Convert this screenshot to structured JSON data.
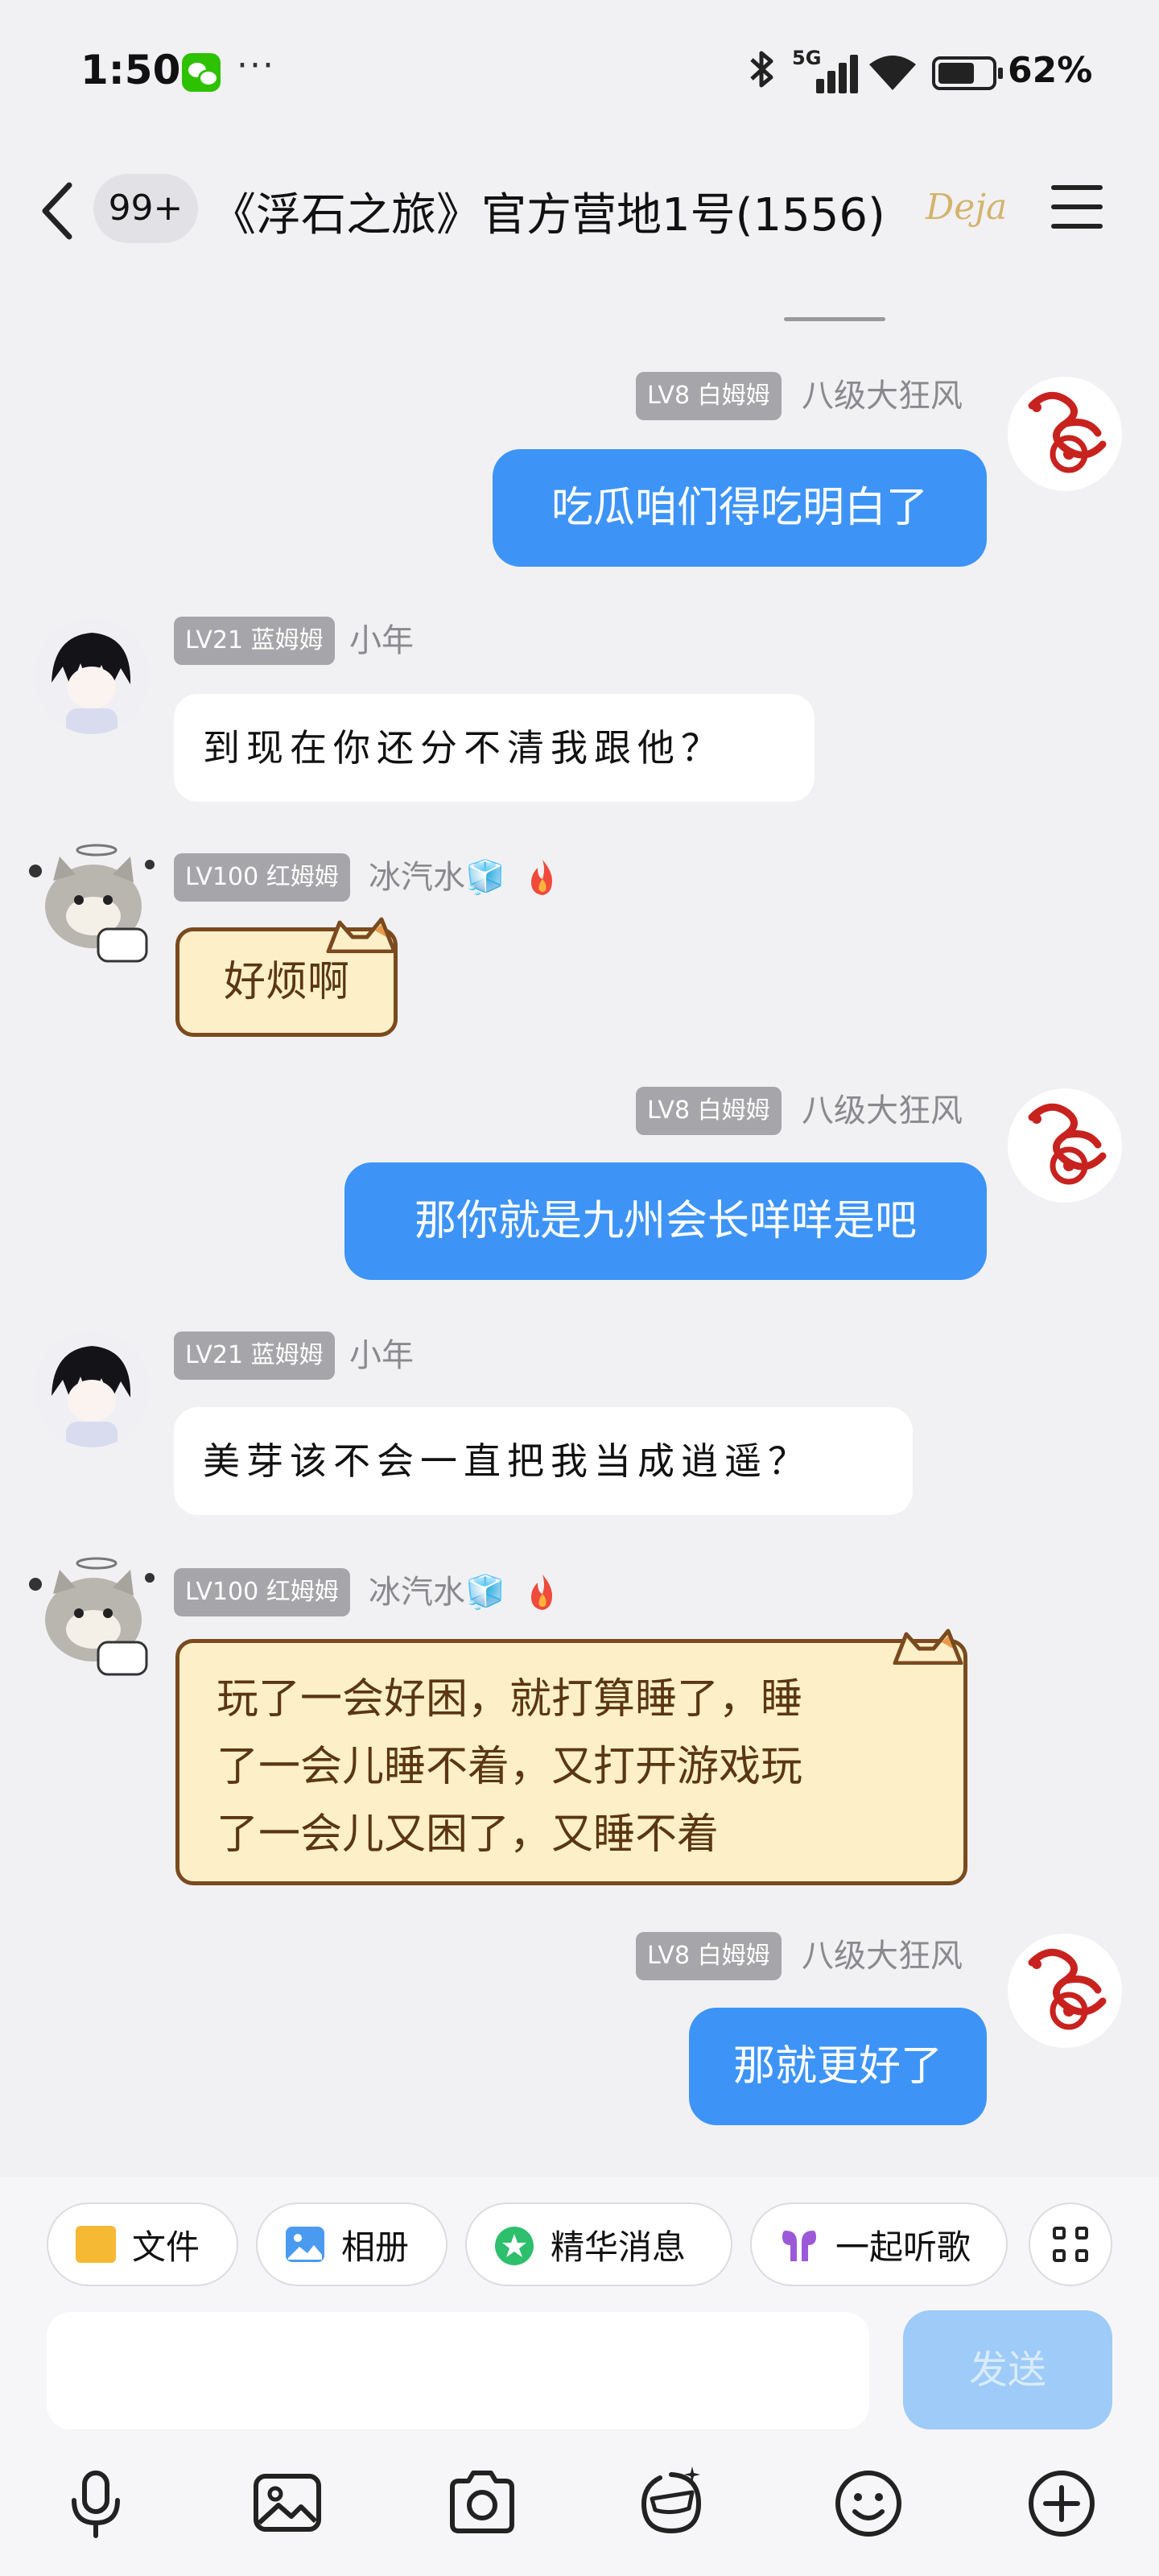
{
  "status_bar": {
    "time": "1:50",
    "more": "···",
    "network": "5G",
    "battery": "62%"
  },
  "header": {
    "unread_badge": "99+",
    "title": "《浮石之旅》官方营地1号(1556)",
    "logo_text": "Deja"
  },
  "messages": [
    {
      "side": "right",
      "level_tag": "LV8 白姆姆",
      "nickname": "八级大狂风",
      "text": "吃瓜咱们得吃明白了"
    },
    {
      "side": "left",
      "level_tag": "LV21 蓝姆姆",
      "nickname": "小年",
      "text": "到现在你还分不清我跟他？"
    },
    {
      "side": "left",
      "level_tag": "LV100 红姆姆",
      "nickname": "冰汽水🧊",
      "text": "好烦啊"
    },
    {
      "side": "right",
      "level_tag": "LV8 白姆姆",
      "nickname": "八级大狂风",
      "text": "那你就是九州会长咩咩是吧"
    },
    {
      "side": "left",
      "level_tag": "LV21 蓝姆姆",
      "nickname": "小年",
      "text": "美芽该不会一直把我当成逍遥？"
    },
    {
      "side": "left",
      "level_tag": "LV100 红姆姆",
      "nickname": "冰汽水🧊",
      "lines": [
        "玩了一会好困，就打算睡了，睡",
        "了一会儿睡不着，又打开游戏玩",
        "了一会儿又困了，又睡不着"
      ]
    },
    {
      "side": "right",
      "level_tag": "LV8 白姆姆",
      "nickname": "八级大狂风",
      "text": "那就更好了"
    }
  ],
  "quick_actions": [
    {
      "label": "文件",
      "icon": "folder-icon"
    },
    {
      "label": "相册",
      "icon": "photo-icon"
    },
    {
      "label": "精华消息",
      "icon": "star-icon"
    },
    {
      "label": "一起听歌",
      "icon": "earbuds-icon"
    }
  ],
  "composer": {
    "placeholder": "",
    "send_label": "发送"
  },
  "toolbar": [
    "mic-icon",
    "image-icon",
    "camera-icon",
    "sticker-icon",
    "emoji-icon",
    "plus-icon"
  ],
  "colors": {
    "accent_blue": "#3d94f6",
    "send_disabled": "#9ecbf7",
    "cat_bubble": "#fdf0c8",
    "background": "#f1f1f4"
  }
}
